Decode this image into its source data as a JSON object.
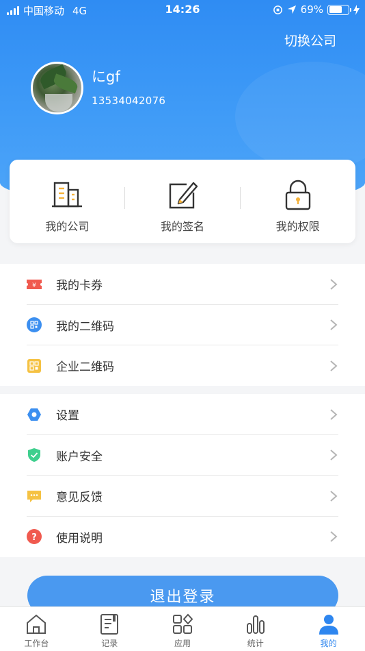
{
  "status_bar": {
    "carrier": "中国移动",
    "network": "4G",
    "time": "14:26",
    "battery": "69%",
    "battery_level": 0.69
  },
  "header": {
    "switch_company": "切换公司",
    "user_name": "にgf",
    "phone": "13534042076"
  },
  "quick_actions": [
    {
      "label": "我的公司",
      "icon": "building-icon"
    },
    {
      "label": "我的签名",
      "icon": "signature-pen-icon"
    },
    {
      "label": "我的权限",
      "icon": "lock-icon"
    }
  ],
  "menu_group_1": [
    {
      "label": "我的卡券",
      "icon": "coupon-icon",
      "color": "#f05a4f"
    },
    {
      "label": "我的二维码",
      "icon": "qrcode-icon",
      "color": "#3c8ff0"
    },
    {
      "label": "企业二维码",
      "icon": "enterprise-qrcode-icon",
      "color": "#f5c243"
    }
  ],
  "menu_group_2": [
    {
      "label": "设置",
      "icon": "settings-hexagon-icon",
      "color": "#3c8ff0"
    },
    {
      "label": "账户安全",
      "icon": "shield-check-icon",
      "color": "#3fcf8e"
    },
    {
      "label": "意见反馈",
      "icon": "feedback-bubble-icon",
      "color": "#f5c243"
    },
    {
      "label": "使用说明",
      "icon": "help-question-icon",
      "color": "#f05a4f"
    }
  ],
  "logout_label": "退出登录",
  "tabbar": {
    "active_color": "#2e86ef",
    "tabs": [
      {
        "label": "工作台",
        "icon": "home-icon",
        "active": false
      },
      {
        "label": "记录",
        "icon": "record-doc-icon",
        "active": false
      },
      {
        "label": "应用",
        "icon": "apps-grid-icon",
        "active": false
      },
      {
        "label": "统计",
        "icon": "bar-chart-icon",
        "active": false
      },
      {
        "label": "我的",
        "icon": "person-icon",
        "active": true
      }
    ]
  }
}
